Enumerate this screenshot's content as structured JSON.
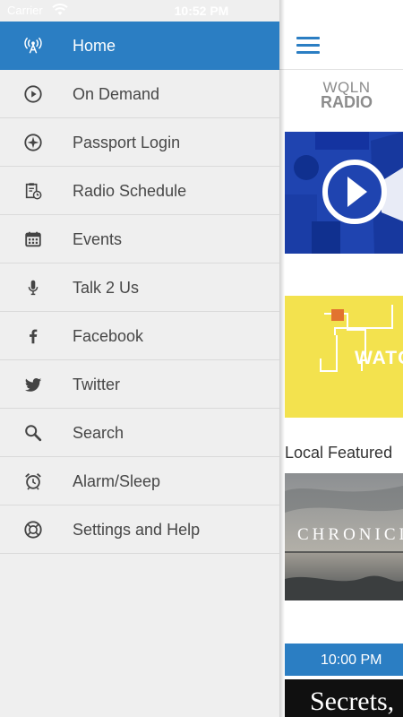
{
  "status_bar": {
    "carrier": "Carrier",
    "time": "10:52 PM"
  },
  "drawer": {
    "items": [
      {
        "label": "Home",
        "icon": "radio-tower-icon",
        "active": true
      },
      {
        "label": "On Demand",
        "icon": "play-circle-icon"
      },
      {
        "label": "Passport Login",
        "icon": "compass-icon"
      },
      {
        "label": "Radio Schedule",
        "icon": "schedule-clipboard-icon"
      },
      {
        "label": "Events",
        "icon": "calendar-icon"
      },
      {
        "label": "Talk 2 Us",
        "icon": "microphone-icon"
      },
      {
        "label": "Facebook",
        "icon": "facebook-icon"
      },
      {
        "label": "Twitter",
        "icon": "twitter-icon"
      },
      {
        "label": "Search",
        "icon": "search-icon"
      },
      {
        "label": "Alarm/Sleep",
        "icon": "alarm-clock-icon"
      },
      {
        "label": "Settings and Help",
        "icon": "help-icon"
      }
    ]
  },
  "main": {
    "logo_line1": "WQLN",
    "logo_line2": "RADIO",
    "watch_text": "WATC",
    "section_title": "Local Featured",
    "chronicle_text": "CHRONICL",
    "time_slot": "10:00 PM",
    "secrets_text": "Secrets,"
  },
  "colors": {
    "accent": "#2b7ec3",
    "drawer_bg": "#efefef",
    "label_text": "#474747",
    "watch_yellow": "#f3e24e",
    "video_blue": "#1f44b0"
  }
}
